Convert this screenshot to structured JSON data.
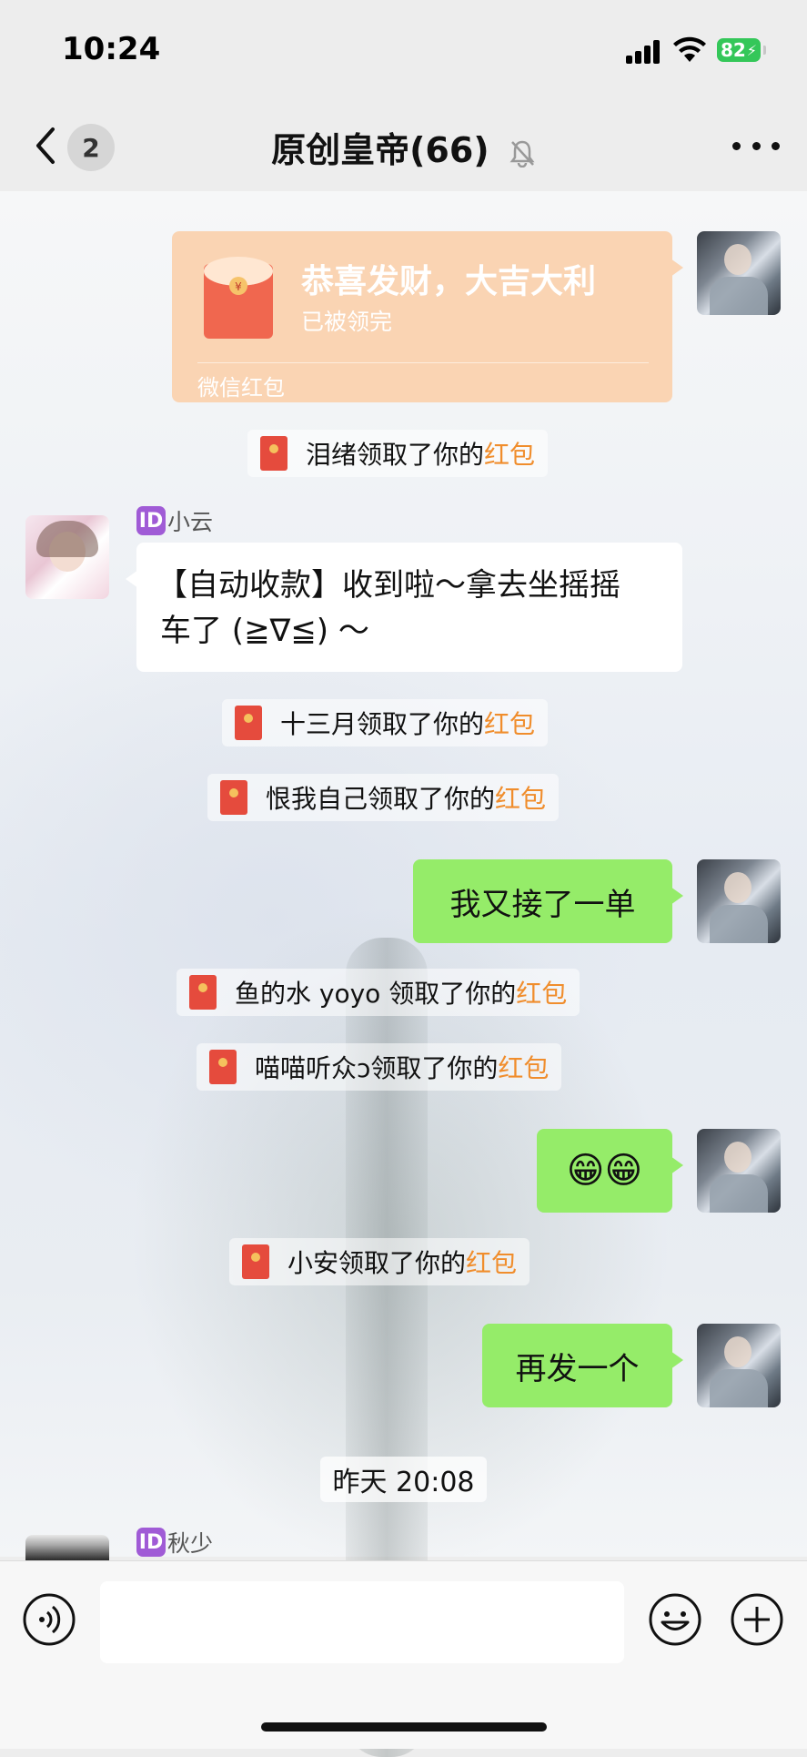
{
  "status_bar": {
    "time": "10:24",
    "battery": "82"
  },
  "nav": {
    "unread_count": "2",
    "title": "原创皇帝(66)"
  },
  "red_packet": {
    "title": "恭喜发财，大吉大利",
    "status": "已被领完",
    "footer": "微信红包"
  },
  "messages": [
    {
      "type": "system",
      "prefix": "泪绪领取了你的",
      "highlight": "红包"
    },
    {
      "type": "incoming",
      "sender": "小云",
      "text_line1": "【自动收款】收到啦～拿去坐摇摇",
      "text_line2": "车了 (≧∇≦) ～"
    },
    {
      "type": "system",
      "prefix": "十三月领取了你的",
      "highlight": "红包"
    },
    {
      "type": "system",
      "prefix": "恨我自己领取了你的",
      "highlight": "红包"
    },
    {
      "type": "outgoing",
      "text": "我又接了一单"
    },
    {
      "type": "system",
      "prefix": "鱼的水 yoyo 领取了你的",
      "highlight": "红包"
    },
    {
      "type": "system",
      "prefix": "喵喵听众ↄ领取了你的",
      "highlight": "红包"
    },
    {
      "type": "outgoing",
      "text": "😁😁"
    },
    {
      "type": "system",
      "prefix": "小安领取了你的",
      "highlight": "红包"
    },
    {
      "type": "outgoing",
      "text": "再发一个"
    },
    {
      "type": "timestamp",
      "text": "昨天 20:08"
    },
    {
      "type": "incoming",
      "sender": "秋少"
    }
  ],
  "id_tag": "ID",
  "input": {
    "placeholder": ""
  },
  "icons": [
    "back-icon",
    "mute-icon",
    "more-icon",
    "red-envelope-icon",
    "voice-icon",
    "emoji-icon",
    "plus-icon"
  ],
  "colors": {
    "bubble_green": "#95ec69",
    "highlight_orange": "#f08d2c",
    "red_packet_bg": "#fad4b3",
    "id_tag_purple": "#a05bd6"
  }
}
